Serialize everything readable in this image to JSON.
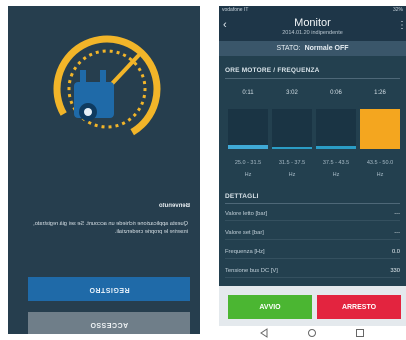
{
  "left_screen": {
    "welcome_title": "Benvenuto",
    "welcome_text": "Questa applicazione richiede un account. Se sei già registrato, inserire le proprie credenziali.",
    "register_button": "REGISTRO",
    "login_button": "ACCESSO",
    "colors": {
      "background": "#263e4e",
      "register": "#1f6aa8",
      "login": "#6f7e89",
      "logo": "#f2b529"
    }
  },
  "right_screen": {
    "status_bar": {
      "carrier": "vodafone IT",
      "right": "32%"
    },
    "header": {
      "title": "Monitor",
      "subtitle": "2014.01.20 indipendente"
    },
    "state": {
      "label": "STATO:",
      "value": "Normale OFF"
    },
    "hours_section": {
      "title": "ORE MOTORE / FREQUENZA",
      "columns": [
        {
          "hours": "0:11",
          "range": "25.0 - 31.5",
          "unit": "Hz",
          "level": 0.1,
          "color": "#3fa9d6"
        },
        {
          "hours": "3:02",
          "range": "31.5 - 37.5",
          "unit": "Hz",
          "level": 0.04,
          "color": "#2b9cc5"
        },
        {
          "hours": "0:06",
          "range": "37.5 - 43.5",
          "unit": "Hz",
          "level": 0.08,
          "color": "#2b9cc5"
        },
        {
          "hours": "1:26",
          "range": "43.5 - 50.0",
          "unit": "Hz",
          "level": 1.0,
          "color": "#f4a61f"
        }
      ]
    },
    "details_section": {
      "title": "DETTAGLI",
      "rows": [
        {
          "label": "Valore letto [bar]",
          "value": "---"
        },
        {
          "label": "Valore set [bar]",
          "value": "---"
        },
        {
          "label": "Frequenza [Hz]",
          "value": "0.0"
        },
        {
          "label": "Tensione bus DC [V]",
          "value": "330"
        }
      ]
    },
    "start_button": "AVVIO",
    "stop_button": "ARRESTO"
  }
}
